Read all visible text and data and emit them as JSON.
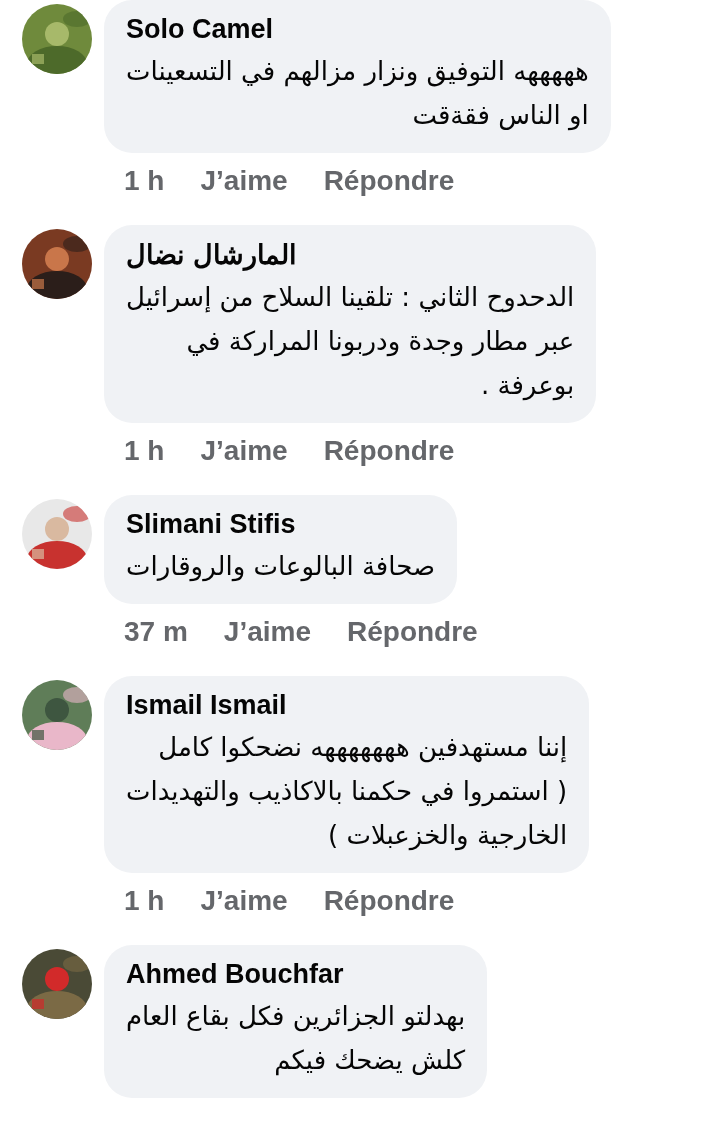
{
  "comments": [
    {
      "author": "Solo Camel",
      "text": "هههههه التوفيق ونزار مزالهم في التسعينات\nاو الناس فقةقت",
      "time": "1 h",
      "like": "J’aime",
      "reply": "Répondre"
    },
    {
      "author": "المارشال نضال",
      "text": "الدحدوح الثاني : تلقينا السلاح من إسرائيل\nعبر مطار وجدة  ودربونا المراركة في\nبوعرفة .",
      "time": "1 h",
      "like": "J’aime",
      "reply": "Répondre"
    },
    {
      "author": "Slimani Stifis",
      "text": "صحافة البالوعات والروقارات",
      "time": "37 m",
      "like": "J’aime",
      "reply": "Répondre"
    },
    {
      "author": "Ismail Ismail",
      "text": "إننا مستهدفين هههههههه نضحكوا كامل\n( استمروا في حكمنا بالاكاذيب والتهديدات\nالخارجية والخزعبلات )",
      "time": "1 h",
      "like": "J’aime",
      "reply": "Répondre"
    },
    {
      "author": "Ahmed Bouchfar",
      "text": "بهدلتو الجزائرين فكل بقاع العام\nكلش يضحك فيكم"
    }
  ]
}
